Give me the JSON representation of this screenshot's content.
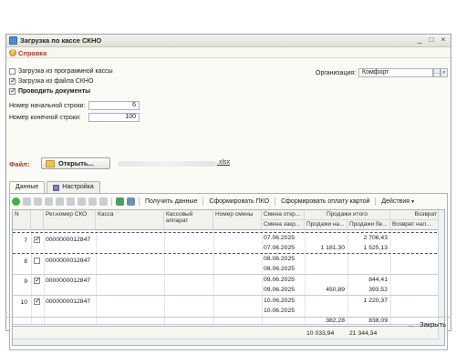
{
  "window": {
    "title": "Загрузка по кассе СКНО",
    "help_label": "Справка"
  },
  "options": {
    "load_from_program": "Загрузка из программной кассы",
    "load_from_file": "Загрузка из файла СКНО",
    "post_documents": "Проводить документы"
  },
  "organization": {
    "label": "Организация:",
    "value": "Комфорт"
  },
  "start_row": {
    "label": "Номер начальной строки:",
    "value": "6"
  },
  "end_row": {
    "label": "Номер конечной строки:",
    "value": "100"
  },
  "file": {
    "label": "Файл:",
    "open_button": "Открыть...",
    "ext": ".xlsx"
  },
  "tabs": [
    {
      "label": "Данные"
    },
    {
      "label": "Настройка"
    }
  ],
  "toolbar": {
    "get_data": "Получить данные",
    "form_pko": "Сформировать ПКО",
    "form_card": "Сформировать оплату картой",
    "actions": "Действия"
  },
  "columns": {
    "n": "N",
    "reg": "Рег.номер СКО",
    "kassa": "Касса",
    "apparat": "Кассовый аппарат",
    "smena": "Номер смены",
    "smena_open": "Смена откр...",
    "smena_close": "Смена закр...",
    "sales_total": "Продажи итого",
    "sales_cash": "Продажи на...",
    "sales_card": "Продажи бе...",
    "return": "Возврат",
    "return_cash": "Возврат нал..."
  },
  "rows": [
    {
      "n": "7",
      "checked": true,
      "reg": "0000000012847",
      "date_open": "07.06.2025",
      "date_close": "07.06.2025",
      "cash": "1 181,30",
      "card_top": "2 706,43",
      "card": "1 525,13"
    },
    {
      "n": "8",
      "checked": false,
      "reg": "0000000012847",
      "date_open": "08.06.2025",
      "date_close": "08.06.2025",
      "cash": "",
      "card_top": "",
      "card": ""
    },
    {
      "n": "9",
      "checked": true,
      "reg": "0000000012847",
      "date_open": "09.06.2025",
      "date_close": "09.06.2025",
      "cash": "450,89",
      "card_top": "844,41",
      "card": "393,52"
    },
    {
      "n": "10",
      "checked": true,
      "reg": "0000000012847",
      "date_open": "10.06.2025",
      "date_close": "10.06.2025",
      "cash": "382,28",
      "card_top": "1 220,37",
      "card": "838,09"
    }
  ],
  "totals": {
    "cash": "10 033,94",
    "card": "21 344,34"
  },
  "bottom": {
    "more": "...",
    "close": "Закрыть"
  },
  "colors": {
    "help": "#c0392b",
    "file_label": "#a23a1e",
    "accent": "#4a8fcf"
  }
}
